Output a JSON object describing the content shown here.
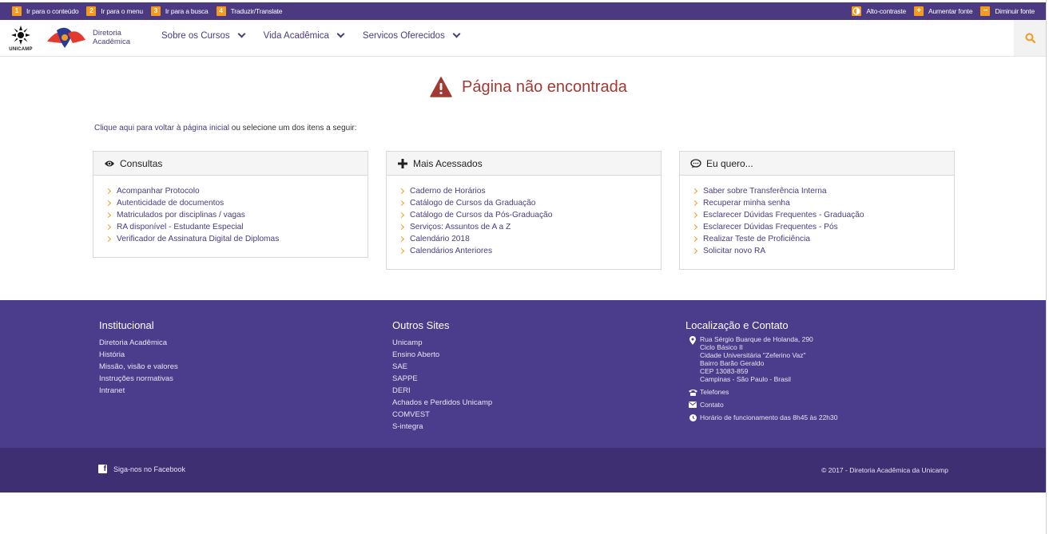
{
  "accessibility": {
    "skip_links": [
      {
        "num": "1",
        "label": "Ir para o conteúdo"
      },
      {
        "num": "2",
        "label": "Ir para o menu"
      },
      {
        "num": "3",
        "label": "Ir para a busca"
      },
      {
        "num": "4",
        "label": "Traduzir/Translate"
      }
    ],
    "contrast_label": "Alto-contraste",
    "increase_font_label": "Aumentar fonte",
    "decrease_font_label": "Diminuir fonte"
  },
  "header": {
    "unicamp_logo_text": "UNICAMP",
    "dac_name_line1": "Diretoria",
    "dac_name_line2": "Acadêmica",
    "nav": [
      {
        "label": "Sobre os Cursos"
      },
      {
        "label": "Vida Acadêmica"
      },
      {
        "label": "Servicos Oferecidos"
      }
    ]
  },
  "main": {
    "title": "Página não encontrada",
    "intro_link": "Clique aqui para voltar à página inicial",
    "intro_text": " ou selecione um dos itens a seguir:",
    "panels": [
      {
        "title": "Consultas",
        "icon": "eye-icon",
        "links": [
          "Acompanhar Protocolo",
          "Autenticidade de documentos",
          "Matriculados por disciplinas / vagas",
          "RA disponível - Estudante Especial",
          "Verificador de Assinatura Digital de Diplomas"
        ]
      },
      {
        "title": "Mais Acessados",
        "icon": "plus-icon",
        "links": [
          "Caderno de Horários",
          "Catálogo de Cursos da Graduação",
          "Catálogo de Cursos da Pós-Graduação",
          "Serviços: Assuntos de A a Z",
          "Calendário 2018",
          "Calendários Anteriores"
        ]
      },
      {
        "title": "Eu quero...",
        "icon": "comment-icon",
        "links": [
          "Saber sobre Transferência Interna",
          "Recuperar minha senha",
          "Esclarecer Dúvidas Frequentes - Graduação",
          "Esclarecer Dúvidas Frequentes - Pós",
          "Realizar Teste de Proficiência",
          "Solicitar novo RA"
        ]
      }
    ]
  },
  "footer": {
    "institucional": {
      "title": "Institucional",
      "links": [
        "Diretoria Acadêmica",
        "História",
        "Missão, visão e valores",
        "Instruções normativas",
        "Intranet"
      ]
    },
    "outros_sites": {
      "title": "Outros Sites",
      "links": [
        "Unicamp",
        "Ensino Aberto",
        "SAE",
        "SAPPE",
        "DERI",
        "Achados e Perdidos Unicamp",
        "COMVEST",
        "S-integra"
      ]
    },
    "contato": {
      "title": "Localização e Contato",
      "address": [
        "Rua Sérgio Buarque de Holanda, 290",
        "Ciclo Básico II",
        "Cidade Universitária \"Zeferino Vaz\"",
        "Bairro Barão Geraldo",
        "CEP 13083-859",
        "Campinas - São Paulo - Brasil"
      ],
      "phones": "Telefones",
      "contact": "Contato",
      "hours": "Horário de funcionamento das 8h45 às 22h30"
    },
    "facebook": "Siga-nos no Facebook",
    "copyright": "© 2017 - Diretoria Acadêmica da Unicamp"
  },
  "colors": {
    "brand_purple": "#4b3a82",
    "accent_orange": "#f39a1f",
    "error_red": "#a23a33"
  }
}
